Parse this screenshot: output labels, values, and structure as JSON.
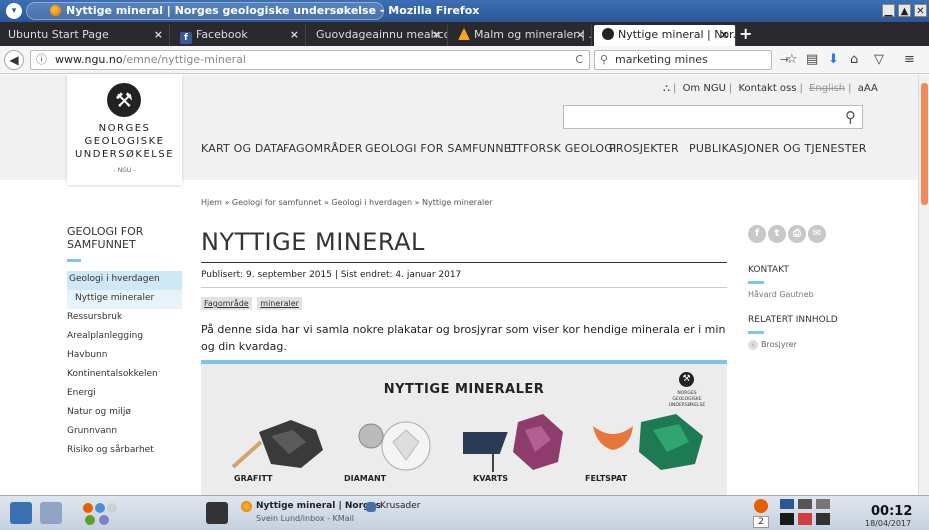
{
  "window": {
    "title": "Nyttige mineral | Norges geologiske undersøkelse - Mozilla Firefox",
    "menu_icon": "chevron-down-icon",
    "controls": [
      "minimize",
      "maximize",
      "close"
    ]
  },
  "tabs": [
    {
      "label": "Ubuntu Start Page",
      "close": "×"
    },
    {
      "label": "Facebook",
      "close": "×",
      "icon": "f"
    },
    {
      "label": "Guovdageainnu meahcc...",
      "close": "×"
    },
    {
      "label": "Malm og mineraler | ...",
      "close": "×"
    },
    {
      "label": "Nyttige mineral | Nor...",
      "close": "×",
      "active": true
    }
  ],
  "newtab_label": "+",
  "nav": {
    "url_domain": "www.ngu.no",
    "url_path": "/emne/nyttige-mineral",
    "reload": "C",
    "search_value": "marketing mines",
    "search_go": "→"
  },
  "site": {
    "logo_lines": [
      "NORGES",
      "GEOLOGISKE",
      "UNDERSØKELSE"
    ],
    "logo_sub": "- NGU -",
    "utility_links": [
      "Om NGU",
      "Kontakt oss",
      "English",
      "aAA"
    ],
    "main_nav": [
      "KART OG DATA",
      "FAGOMRÅDER",
      "GEOLOGI FOR SAMFUNNET",
      "UTFORSK GEOLOGI",
      "PROSJEKTER",
      "PUBLIKASJONER OG TJENESTER"
    ],
    "breadcrumb": "Hjem » Geologi for samfunnet » Geologi i hverdagen » Nyttige mineraler"
  },
  "sidebar": {
    "heading": "GEOLOGI FOR SAMFUNNET",
    "items": [
      {
        "label": "Geologi i hverdagen",
        "state": "active"
      },
      {
        "label": "Nyttige mineraler",
        "state": "sub"
      },
      {
        "label": "Ressursbruk"
      },
      {
        "label": "Arealplanlegging"
      },
      {
        "label": "Havbunn"
      },
      {
        "label": "Kontinentalsokkelen"
      },
      {
        "label": "Energi"
      },
      {
        "label": "Natur og miljø"
      },
      {
        "label": "Grunnvann"
      },
      {
        "label": "Risiko og sårbarhet"
      }
    ]
  },
  "article": {
    "title": "NYTTIGE MINERAL",
    "published": "Publisert: 9. september 2015 | Sist endret: 4. januar 2017",
    "tags": [
      "Fagområde",
      "mineraler"
    ],
    "intro": "På denne sida har vi samla nokre plakatar og brosjyrar som viser kor hendige minerala er i min og din kvardag."
  },
  "poster": {
    "title": "NYTTIGE MINERALER",
    "logo_text": "NORGES GEOLOGISKE UNDERSØKELSE",
    "minerals": [
      "GRAFITT",
      "DIAMANT",
      "KVARTS",
      "FELTSPAT"
    ]
  },
  "right": {
    "contact_head": "KONTAKT",
    "contact_name": "Håvard Gautneb",
    "related_head": "RELATERT INNHOLD",
    "related_link": "Brosjyrer"
  },
  "taskbar": {
    "task1": "Nyttige mineral | Norges",
    "task1_sub": "Svein Lund/inbox - KMail",
    "task2": "Krusader",
    "desk_num": "2",
    "clock": "00:12",
    "date": "18/04/2017"
  },
  "colors": {
    "accent": "#7ec4e8",
    "titlebar": "#2b5797",
    "tabbar": "#2a2a2e",
    "scroll_thumb": "#f28a5a"
  }
}
